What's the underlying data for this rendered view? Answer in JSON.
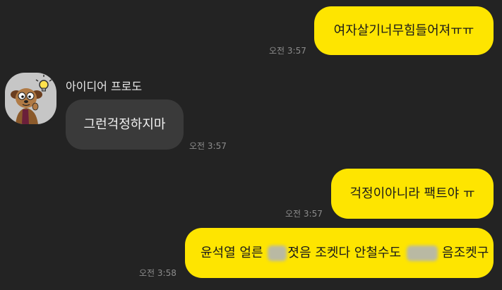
{
  "colors": {
    "background": "#232323",
    "my_bubble": "#fee500",
    "other_bubble": "#3a3a3a",
    "timestamp": "#8c8c8c"
  },
  "contact": {
    "name": "아이디어 프로도",
    "avatar_icon": "frodo-character-avatar-icon"
  },
  "messages": [
    {
      "sender": "me",
      "text": "여자살기너무힘들어져ㅠㅠ",
      "time": "오전 3:57"
    },
    {
      "sender": "other",
      "text": "그런걱정하지마",
      "time": "오전 3:57"
    },
    {
      "sender": "me",
      "text": "걱정이아니라 팩트야 ㅠ",
      "time": "오전 3:57"
    },
    {
      "sender": "me",
      "text_part1": "윤석열 얼른",
      "text_part2": "졋음 조켓다 안철수도",
      "text_part3": "음조켓구",
      "time": "오전 3:58",
      "redacted_segments": 2
    }
  ]
}
